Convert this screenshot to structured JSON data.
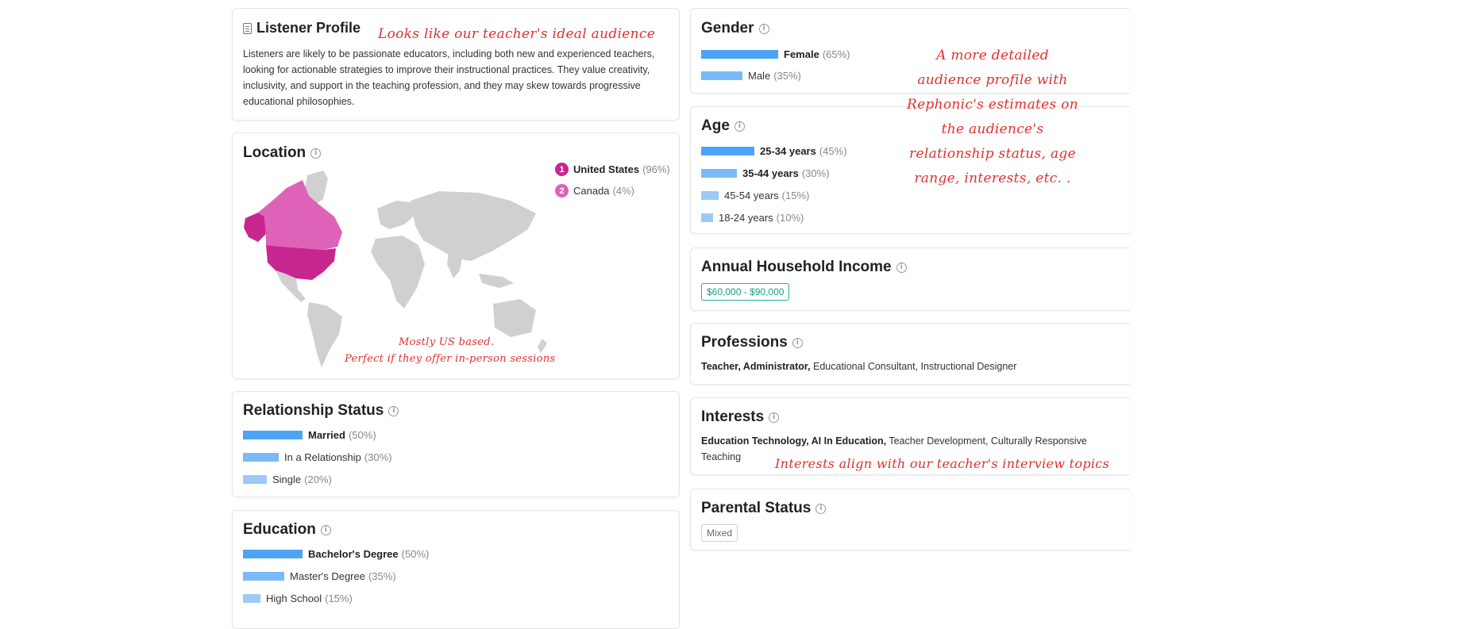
{
  "colors": {
    "primary_bar": "#4da3f5",
    "us_magenta": "#c8268f",
    "canada_pink": "#de62b8",
    "annotation_red": "#e0312f",
    "income_green": "#18a37a"
  },
  "listener_profile": {
    "title": "Listener Profile",
    "icon": "document-icon",
    "description": "Listeners are likely to be passionate educators, including both new and experienced teachers, looking for actionable strategies to improve their instructional practices. They value creativity, inclusivity, and support in the teaching profession, and they may skew towards progressive educational philosophies."
  },
  "location": {
    "title": "Location",
    "items": [
      {
        "rank": "1",
        "name": "United States",
        "percent": "(96%)"
      },
      {
        "rank": "2",
        "name": "Canada",
        "percent": "(4%)"
      }
    ]
  },
  "relationship": {
    "title": "Relationship Status",
    "items": [
      {
        "label": "Married",
        "percent": "(50%)",
        "value": 50
      },
      {
        "label": "In a Relationship",
        "percent": "(30%)",
        "value": 30
      },
      {
        "label": "Single",
        "percent": "(20%)",
        "value": 20
      }
    ]
  },
  "education": {
    "title": "Education",
    "items": [
      {
        "label": "Bachelor's Degree",
        "percent": "(50%)",
        "value": 50
      },
      {
        "label": "Master's Degree",
        "percent": "(35%)",
        "value": 35
      },
      {
        "label": "High School",
        "percent": "(15%)",
        "value": 15
      }
    ]
  },
  "gender": {
    "title": "Gender",
    "items": [
      {
        "label": "Female",
        "percent": "(65%)",
        "value": 65
      },
      {
        "label": "Male",
        "percent": "(35%)",
        "value": 35
      }
    ]
  },
  "age": {
    "title": "Age",
    "items": [
      {
        "label": "25-34 years",
        "percent": "(45%)",
        "value": 45
      },
      {
        "label": "35-44 years",
        "percent": "(30%)",
        "value": 30
      },
      {
        "label": "45-54 years",
        "percent": "(15%)",
        "value": 15
      },
      {
        "label": "18-24 years",
        "percent": "(10%)",
        "value": 10
      }
    ]
  },
  "income": {
    "title": "Annual Household Income",
    "value": "$60,000 - $90,000"
  },
  "professions": {
    "title": "Professions",
    "bold": "Teacher, Administrator,",
    "rest": " Educational Consultant, Instructional Designer"
  },
  "interests": {
    "title": "Interests",
    "bold": "Education Technology, AI In Education,",
    "rest": " Teacher Development, Culturally Responsive Teaching"
  },
  "parental": {
    "title": "Parental Status",
    "value": "Mixed"
  },
  "annotations": {
    "top": "Looks like our teacher's ideal audience",
    "map1": "Mostly US based.",
    "map2": "Perfect if they offer in-person sessions",
    "right": [
      "A more detailed",
      "audience profile with",
      "Rephonic's estimates on",
      "the audience's",
      "relationship status, age",
      "range, interests, etc. ."
    ],
    "interests": "Interests align with our teacher's interview topics"
  }
}
